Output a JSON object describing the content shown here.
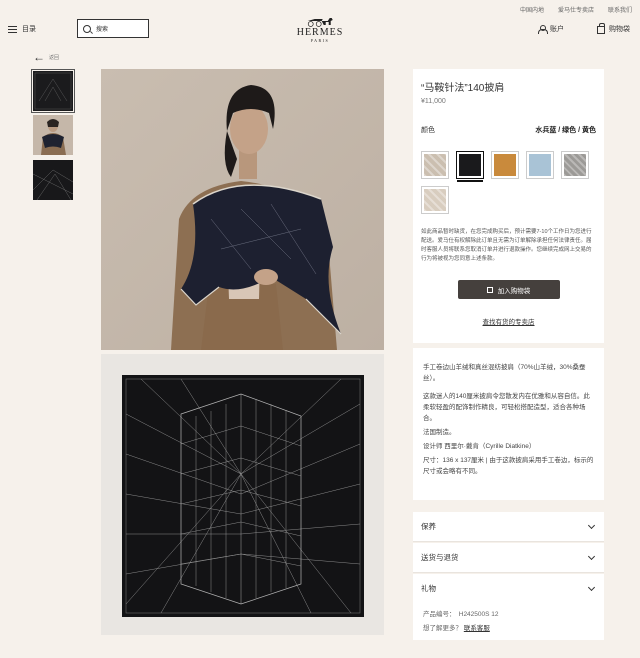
{
  "header": {
    "top_links": [
      "中国内地",
      "爱马仕专卖店",
      "联系我们"
    ],
    "menu_label": "目录",
    "search_placeholder": "搜索",
    "logo_name": "HERMES",
    "logo_sub": "PARIS",
    "account_label": "账户",
    "cart_label": "购物袋"
  },
  "nav": {
    "back_label": "返回"
  },
  "product": {
    "title": "“马鞍针法”140披肩",
    "price": "¥11,000",
    "color_label": "颜色",
    "color_value": "水兵蓝 / 绿色 / 黄色",
    "swatches": [
      {
        "color": "#cbbfb0",
        "selected": false
      },
      {
        "color": "#1a1a1c",
        "selected": true
      },
      {
        "color": "#c98a3c",
        "selected": false
      },
      {
        "color": "#a9c3d6",
        "selected": false
      },
      {
        "color": "#9c9a97",
        "selected": false
      },
      {
        "color": "#d8cdbf",
        "selected": false
      }
    ],
    "notice": "如此商品暂时缺货，在您完成购买后，预计需要7-10个工作日为您进行配送。爱马仕有权解除此订单且无需为订单解除承担任何法律责任。届时客服人员将联系您取消订单并进行退款操作。您继续完成网上交易的行为将被视为您同意上述条款。",
    "add_to_cart": "加入购物袋",
    "store_link": "查找有货的专卖店"
  },
  "description": {
    "p1": "手工卷边山羊绒和真丝混纺披肩（70%山羊绒，30%桑蚕丝）。",
    "p2": "这款迷人的140厘米披肩令您散发内在优雅和从容自信。此柔软轻盈的配饰制作精良，可轻松搭配造型，适合各种场合。",
    "p3": "法国制造。",
    "p4": "设计师 西里尔·戴肯（Cyrille Diatkine）",
    "p5": "尺寸：136 x 137厘米 | 由于这款披肩采用手工卷边，标示的尺寸或会略有不同。"
  },
  "accordion": [
    {
      "label": "保养"
    },
    {
      "label": "送货与退货"
    },
    {
      "label": "礼物"
    }
  ],
  "footer_info": {
    "product_code": "产品编号：　H242500S 12",
    "question": "想了解更多？",
    "contact": "联系客服"
  }
}
